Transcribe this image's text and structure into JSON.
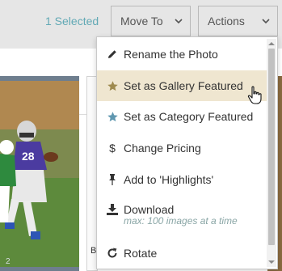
{
  "toolbar": {
    "selected_count": "1 Selected",
    "move_to_label": "Move To",
    "actions_label": "Actions"
  },
  "cards": [
    {
      "number": "2"
    },
    {
      "letter": "B"
    }
  ],
  "menu": {
    "items": [
      {
        "label": "Rename the Photo",
        "icon": "pencil-icon"
      },
      {
        "label": "Set as Gallery Featured",
        "icon": "star-icon",
        "highlighted": true
      },
      {
        "label": "Set as Category Featured",
        "icon": "star-icon"
      },
      {
        "label": "Change Pricing",
        "icon": "dollar-icon"
      },
      {
        "label": "Add to 'Highlights'",
        "icon": "pin-icon"
      },
      {
        "label": "Download",
        "sublabel": "max: 100 images at a time",
        "icon": "download-icon"
      },
      {
        "label": "Rotate",
        "icon": "rotate-icon"
      }
    ]
  },
  "colors": {
    "accent": "#62a9b5",
    "highlight_bg": "#efe6d0",
    "gallery_star": "#9e8a4e",
    "category_star": "#5f97b0"
  }
}
